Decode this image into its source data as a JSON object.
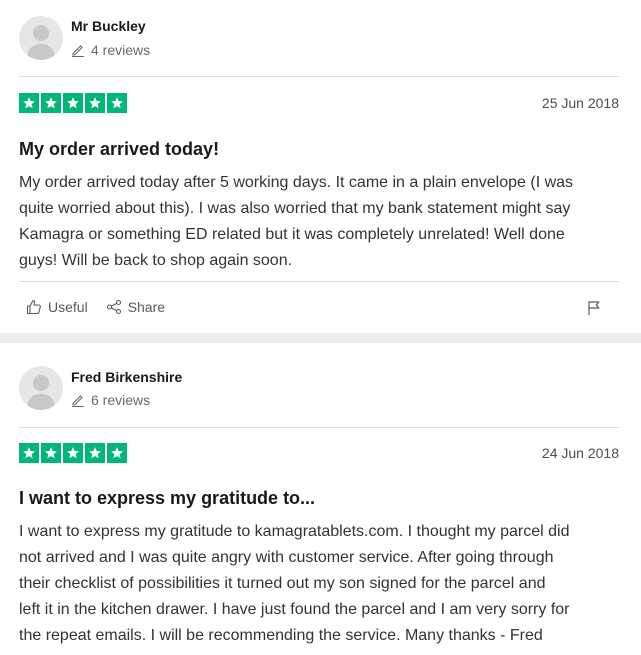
{
  "reviews": [
    {
      "author": "Mr Buckley",
      "review_count": "4 reviews",
      "rating": 5,
      "date": "25 Jun 2018",
      "title": "My order arrived today!",
      "body_lines": [
        "My order arrived today after 5 working days. It came in a plain envelope (I was",
        "quite worried about this). I was also worried that my bank statement might say",
        "Kamagra or something ED related but it was completely unrelated! Well done",
        "guys! Will be back to shop again soon."
      ],
      "useful_label": "Useful",
      "share_label": "Share"
    },
    {
      "author": "Fred Birkenshire",
      "review_count": "6 reviews",
      "rating": 5,
      "date": "24 Jun 2018",
      "title": "I want to express my gratitude to...",
      "body_lines": [
        "I want to express my gratitude to kamagratablets.com. I thought my parcel did",
        "not arrived and I was quite angry with customer service. After going through",
        "their checklist of possibilities it turned out my son signed for the parcel and",
        "left it in the kitchen drawer. I have just found the parcel and I am very sorry for",
        "the repeat emails. I will be recommending the service. Many thanks - Fred"
      ]
    }
  ],
  "colors": {
    "star_green": "#00b67a",
    "divider": "#dcdce6",
    "text_muted": "#696a6a"
  },
  "icons": {
    "avatar": "person-silhouette-icon",
    "reviews": "pencil-icon",
    "useful": "thumbs-up-icon",
    "share": "share-icon",
    "flag": "flag-icon",
    "star": "star-icon"
  }
}
